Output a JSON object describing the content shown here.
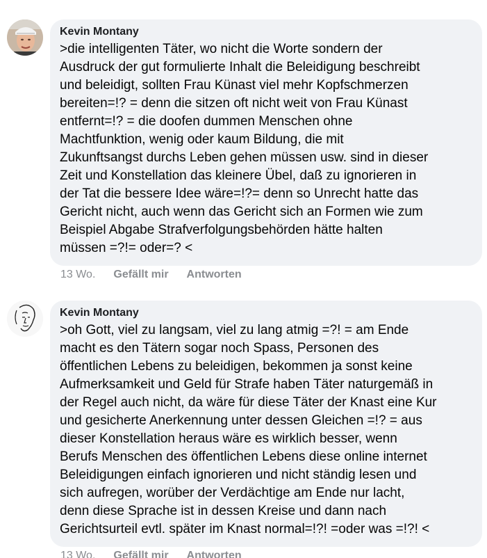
{
  "comments": [
    {
      "author": "Kevin Montany",
      "avatar_icon": "user-photo-icon",
      "text": ">die intelligenten Täter, wo nicht die Worte sondern der\nAusdruck der gut formulierte Inhalt die Beleidigung beschreibt\nund beleidigt, sollten Frau Künast viel mehr Kopfschmerzen\nbereiten=!? = denn die sitzen oft nicht weit von Frau Künast\nentfernt=!? = die  doofen dummen Menschen ohne\nMachtfunktion, wenig oder kaum Bildung, die mit\nZukunftsangst durchs Leben gehen müssen usw. sind in dieser\nZeit und Konstellation das kleinere Übel, daß zu ignorieren in\nder Tat die bessere Idee wäre=!?= denn so Unrecht hatte das\nGericht nicht, auch wenn das Gericht sich an Formen wie zum\nBeispiel Abgabe Strafverfolgungsbehörden hätte halten\nmüssen =?!= oder=? <",
      "time": "13 Wo.",
      "like_label": "Gefällt mir",
      "reply_label": "Antworten"
    },
    {
      "author": "Kevin Montany",
      "avatar_icon": "face-sketch-icon",
      "text": ">oh Gott, viel zu langsam, viel zu lang atmig =?! = am Ende\nmacht es den Tätern sogar noch Spass, Personen des\nöffentlichen Lebens zu beleidigen, bekommen  ja sonst keine\nAufmerksamkeit und Geld für Strafe haben Täter naturgemäß in\nder Regel auch nicht, da wäre für diese Täter der Knast eine Kur\nund gesicherte Anerkennung unter dessen Gleichen =!? = aus\ndieser Konstellation heraus wäre es wirklich besser, wenn\nBerufs Menschen des öffentlichen Lebens diese online internet\nBeleidigungen einfach ignorieren und nicht ständig lesen und\nsich aufregen, worüber der Verdächtige am Ende nur lacht,\ndenn diese Sprache ist in dessen Kreise und dann nach\nGerichtsurteil evtl. später im Knast normal=!?! =oder was =!?! <",
      "time": "13 Wo.",
      "like_label": "Gefällt mir",
      "reply_label": "Antworten"
    }
  ]
}
